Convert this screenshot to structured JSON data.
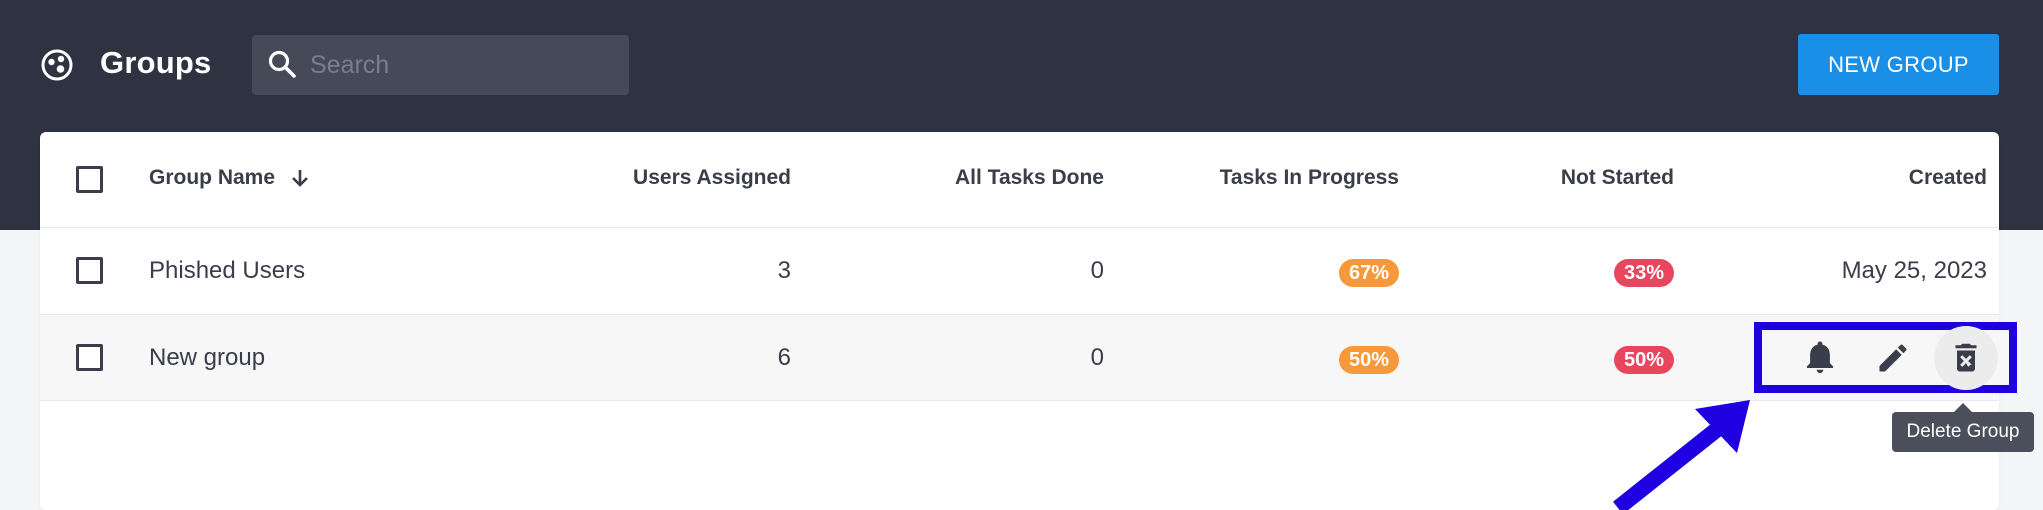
{
  "app": {
    "title": "Groups"
  },
  "search": {
    "placeholder": "Search",
    "value": ""
  },
  "toolbar": {
    "new_group_label": "NEW GROUP"
  },
  "table": {
    "columns": {
      "name": "Group Name",
      "users": "Users Assigned",
      "done": "All Tasks Done",
      "progress": "Tasks In Progress",
      "not_started": "Not Started",
      "created": "Created"
    },
    "rows": [
      {
        "name": "Phished Users",
        "users": "3",
        "done": "0",
        "progress": "67%",
        "not_started": "33%",
        "created": "May 25, 2023"
      },
      {
        "name": "New group",
        "users": "6",
        "done": "0",
        "progress": "50%",
        "not_started": "50%",
        "created": ""
      }
    ]
  },
  "actions": {
    "icons": [
      "bell-icon",
      "pencil-icon",
      "delete-icon"
    ]
  },
  "tooltip": {
    "text": "Delete Group"
  },
  "colors": {
    "topbar": "#2f3241",
    "accent": "#1a8fe8",
    "badge_progress": "#f7983a",
    "badge_not_started": "#e8455f",
    "highlight": "#1e00e0"
  }
}
